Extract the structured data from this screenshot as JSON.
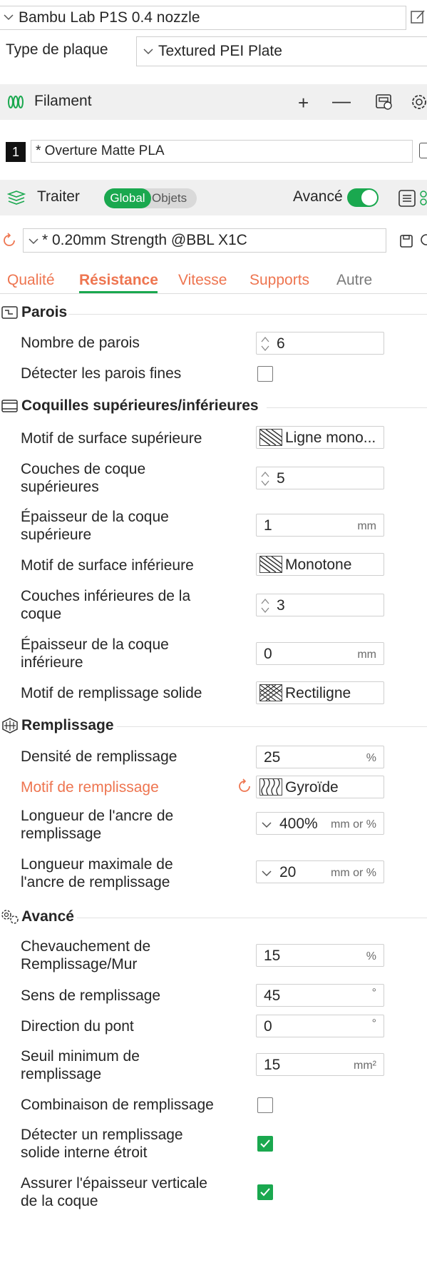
{
  "printer": {
    "name": "Bambu Lab P1S 0.4 nozzle"
  },
  "plate": {
    "label": "Type de plaque",
    "value": "Textured PEI Plate"
  },
  "filament": {
    "title": "Filament",
    "slot": "1",
    "name": "* Overture Matte PLA"
  },
  "process": {
    "title": "Traiter",
    "toggle_global": "Global",
    "toggle_objects": "Objets",
    "advanced_label": "Avancé"
  },
  "preset": {
    "name": "* 0.20mm Strength @BBL X1C"
  },
  "tabs": {
    "quality": "Qualité",
    "strength": "Résistance",
    "speed": "Vitesse",
    "supports": "Supports",
    "other": "Autre"
  },
  "walls": {
    "title": "Parois",
    "count_label": "Nombre de parois",
    "count_value": "6",
    "thin_label": "Détecter les parois fines"
  },
  "shells": {
    "title": "Coquilles supérieures/inférieures",
    "top_pattern_label": "Motif de surface supérieure",
    "top_pattern_value": "Ligne mono...",
    "top_layers_label": "Couches de coque supérieures",
    "top_layers_value": "5",
    "top_thickness_label": "Épaisseur de la coque supérieure",
    "top_thickness_value": "1",
    "top_thickness_unit": "mm",
    "bottom_pattern_label": "Motif de surface inférieure",
    "bottom_pattern_value": "Monotone",
    "bottom_layers_label": "Couches inférieures de la coque",
    "bottom_layers_value": "3",
    "bottom_thickness_label": "Épaisseur de la coque inférieure",
    "bottom_thickness_value": "0",
    "bottom_thickness_unit": "mm",
    "solid_pattern_label": "Motif de remplissage solide",
    "solid_pattern_value": "Rectiligne"
  },
  "infill": {
    "title": "Remplissage",
    "density_label": "Densité de remplissage",
    "density_value": "25",
    "density_unit": "%",
    "pattern_label": "Motif de remplissage",
    "pattern_value": "Gyroïde",
    "anchor_label": "Longueur de l'ancre de remplissage",
    "anchor_value": "400%",
    "anchor_unit": "mm or %",
    "anchor_max_label": "Longueur maximale de l'ancre de remplissage",
    "anchor_max_value": "20",
    "anchor_max_unit": "mm or %"
  },
  "advanced": {
    "title": "Avancé",
    "overlap_label": "Chevauchement de Remplissage/Mur",
    "overlap_value": "15",
    "overlap_unit": "%",
    "direction_label": "Sens de remplissage",
    "direction_value": "45",
    "direction_unit": "°",
    "bridge_label": "Direction du pont",
    "bridge_value": "0",
    "bridge_unit": "°",
    "threshold_label": "Seuil minimum de remplissage",
    "threshold_value": "15",
    "threshold_unit": "mm²",
    "combine_label": "Combinaison de remplissage",
    "narrow_label": "Détecter un remplissage solide interne étroit",
    "vertical_label": "Assurer l'épaisseur verticale de la coque"
  },
  "colors": {
    "accent": "#ee7550",
    "green": "#1aa84f",
    "header_bg": "#f0f0f0"
  }
}
